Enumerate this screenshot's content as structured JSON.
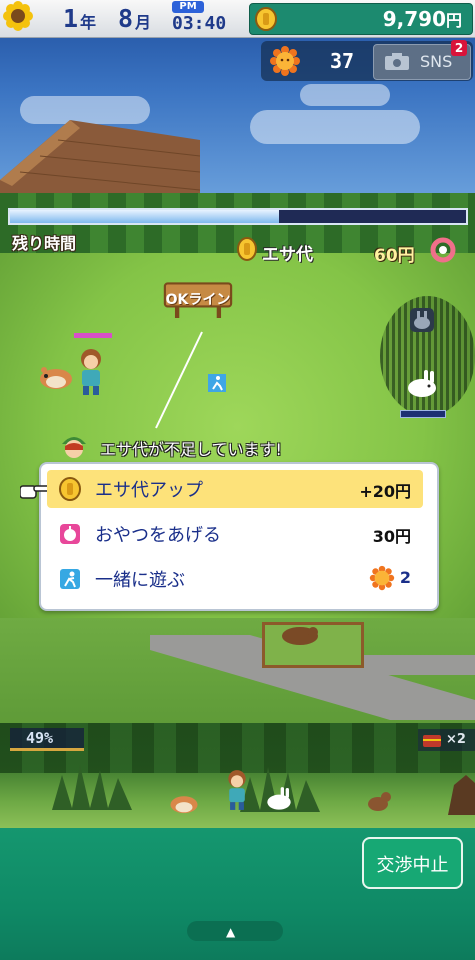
{
  "status_bar": {
    "year": "1",
    "year_unit": "年",
    "month": "8",
    "month_unit": "月",
    "ampm": "PM",
    "time": "03:40",
    "money": "9,790",
    "money_unit": "円"
  },
  "social": {
    "sun_count": "37",
    "sns_label": "SNS",
    "sns_badge": "2"
  },
  "field": {
    "time_label": "残り時間",
    "time_remaining_fraction": 0.59,
    "food_cost_label": "エサ代",
    "food_cost_value": "60円",
    "ok_line_label": "OKライン"
  },
  "message": "エサ代が不足しています!",
  "menu": {
    "options": [
      {
        "label": "エサ代アップ",
        "value": "+20円",
        "icon": "coin-icon",
        "selected": true
      },
      {
        "label": "おやつをあげる",
        "value": "30円",
        "icon": "apple-icon",
        "selected": false
      },
      {
        "label": "一緒に遊ぶ",
        "value": "2",
        "icon": "runner-icon",
        "value_icon": "sun-icon",
        "selected": false
      }
    ]
  },
  "lower_strip": {
    "percent": "49%",
    "chest_count": "×2"
  },
  "bottom": {
    "quit_label": "交渉中止"
  },
  "colors": {
    "brand_green": "#15976f",
    "money_box": "#1c8a6f",
    "text_blue": "#1f3a8a",
    "highlight": "#fde27a"
  }
}
